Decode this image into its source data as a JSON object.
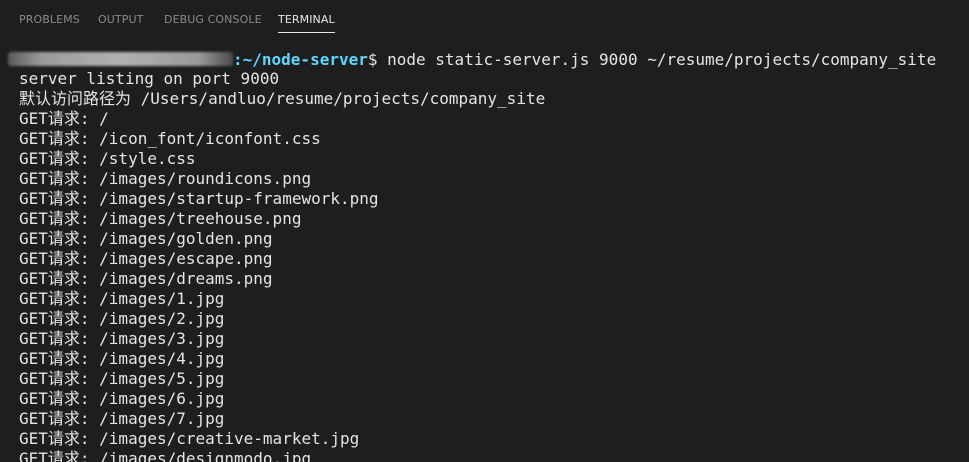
{
  "tabs": [
    {
      "label": "PROBLEMS",
      "active": false
    },
    {
      "label": "OUTPUT",
      "active": false
    },
    {
      "label": "DEBUG CONSOLE",
      "active": false
    },
    {
      "label": "TERMINAL",
      "active": true
    }
  ],
  "prompt": {
    "path": ":~/node-server",
    "symbol": "$ ",
    "command": "node static-server.js 9000 ~/resume/projects/company_site"
  },
  "output_lines": [
    "server listing on port 9000",
    "默认访问路径为 /Users/andluo/resume/projects/company_site",
    "GET请求: /",
    "GET请求: /icon_font/iconfont.css",
    "GET请求: /style.css",
    "GET请求: /images/roundicons.png",
    "GET请求: /images/startup-framework.png",
    "GET请求: /images/treehouse.png",
    "GET请求: /images/golden.png",
    "GET请求: /images/escape.png",
    "GET请求: /images/dreams.png",
    "GET请求: /images/1.jpg",
    "GET请求: /images/2.jpg",
    "GET请求: /images/3.jpg",
    "GET请求: /images/4.jpg",
    "GET请求: /images/5.jpg",
    "GET请求: /images/6.jpg",
    "GET请求: /images/7.jpg",
    "GET请求: /images/creative-market.jpg",
    "GET请求: /images/designmodo.jpg"
  ],
  "colors": {
    "background": "#1e1e1e",
    "text": "#e5e5e5",
    "prompt_path": "#5fd7ff",
    "tab_inactive": "#8b8b8b",
    "tab_active": "#e7e7e7"
  }
}
